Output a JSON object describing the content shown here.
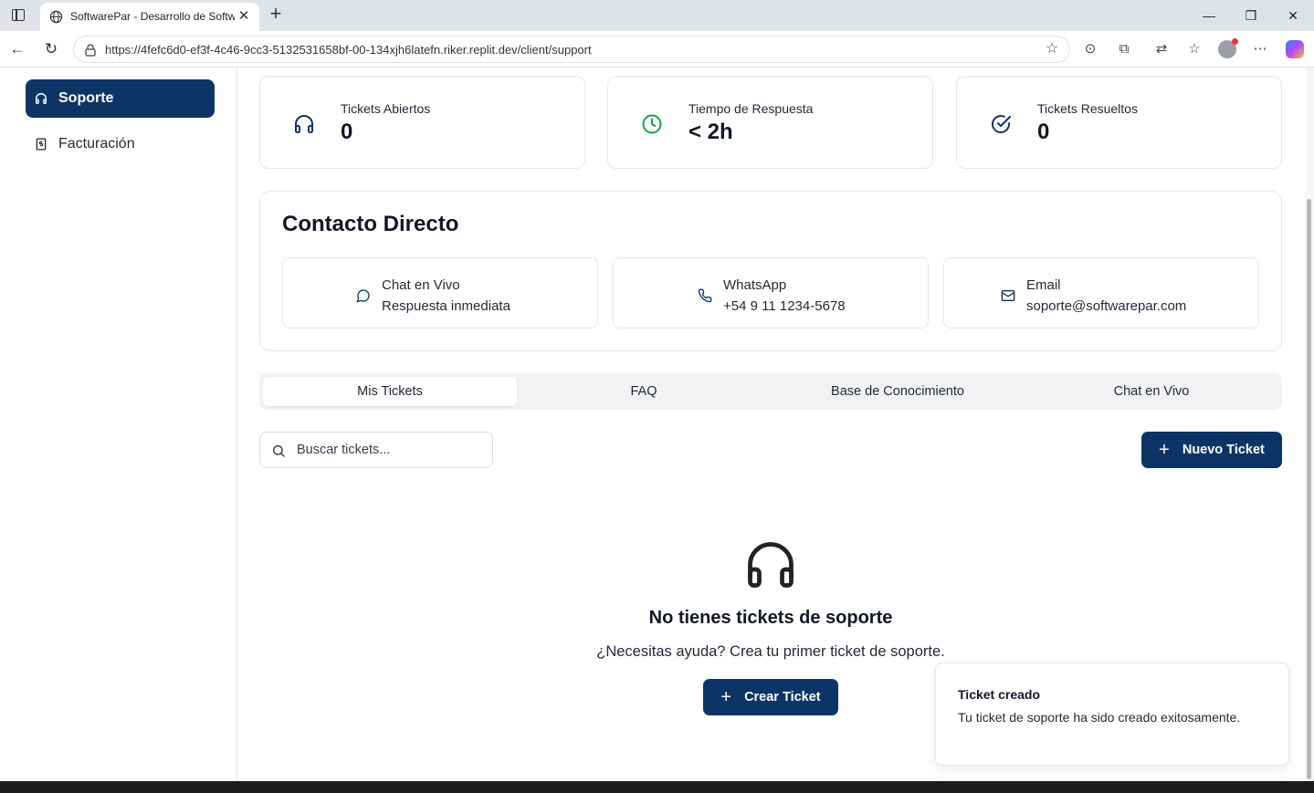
{
  "browser": {
    "tab_title": "SoftwarePar - Desarrollo de Software",
    "url": "https://4fefc6d0-ef3f-4c46-9cc3-5132531658bf-00-134xjh6latefn.riker.replit.dev/client/support"
  },
  "sidebar": {
    "items": [
      {
        "label": "Soporte",
        "icon": "headphones-icon"
      },
      {
        "label": "Facturación",
        "icon": "receipt-icon"
      }
    ]
  },
  "stats": [
    {
      "label": "Tickets Abiertos",
      "value": "0",
      "icon": "headphones-icon",
      "color": "#0c3566"
    },
    {
      "label": "Tiempo de Respuesta",
      "value": "< 2h",
      "icon": "clock-icon",
      "color": "#16a34a"
    },
    {
      "label": "Tickets Resueltos",
      "value": "0",
      "icon": "check-circle-icon",
      "color": "#0c3566"
    }
  ],
  "contact": {
    "title": "Contacto Directo",
    "items": [
      {
        "label": "Chat en Vivo",
        "detail": "Respuesta inmediata",
        "icon": "message-circle-icon"
      },
      {
        "label": "WhatsApp",
        "detail": "+54 9 11 1234-5678",
        "icon": "phone-icon"
      },
      {
        "label": "Email",
        "detail": "soporte@softwarepar.com",
        "icon": "mail-icon"
      }
    ]
  },
  "tabs": [
    {
      "label": "Mis Tickets",
      "active": true
    },
    {
      "label": "FAQ",
      "active": false
    },
    {
      "label": "Base de Conocimiento",
      "active": false
    },
    {
      "label": "Chat en Vivo",
      "active": false
    }
  ],
  "search": {
    "placeholder": "Buscar tickets..."
  },
  "new_ticket_label": "Nuevo Ticket",
  "empty_state": {
    "title": "No tienes tickets de soporte",
    "subtitle": "¿Necesitas ayuda? Crea tu primer ticket de soporte.",
    "button_label": "Crear Ticket"
  },
  "toast": {
    "title": "Ticket creado",
    "description": "Tu ticket de soporte ha sido creado exitosamente."
  },
  "colors": {
    "primary": "#0c3566",
    "success": "#16a34a"
  }
}
